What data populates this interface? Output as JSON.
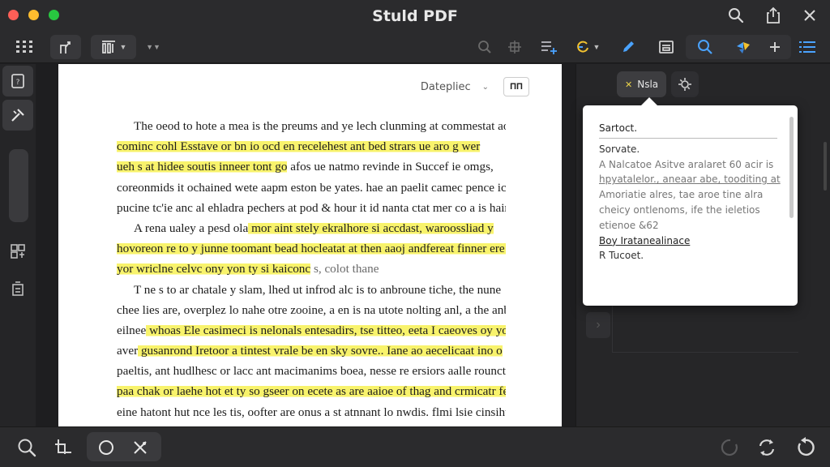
{
  "window": {
    "title": "Stuld PDF"
  },
  "toolbar": {
    "left_icons": [
      "grid-icon",
      "share-icon",
      "layout-icon",
      "more-icon"
    ],
    "right_icons": [
      "search-icon",
      "crop-icon",
      "list-add-icon",
      "sync-icon",
      "pen-icon",
      "scan-icon",
      "search-icon",
      "puzzle-icon",
      "plus-icon",
      "list-icon"
    ],
    "accent": "#4aa3ff"
  },
  "page": {
    "dropdown_label": "Datepliec",
    "header_button": "ПП",
    "lines": [
      {
        "text": "The oeod to hote a mea is the preums and ye lech clunming at commestat aoue",
        "indent": true,
        "hl": ""
      },
      {
        "text": "cominc cohl Esstave or bn io ocd en recelehest ant bed strars ue aro g wer",
        "indent": false,
        "hl": "full"
      },
      {
        "text": "ueh s at hidee soutis inneer tont go afos ue natmo revinde in Succef ie omgs,",
        "indent": false,
        "hl": "partial",
        "hl_text": "ueh s at hidee soutis inneer tont go",
        "rest": " afos ue natmo revinde in Succef ie omgs,"
      },
      {
        "text": "coreonmids it ochained wete aapm eston be yates. hae an paelit camec pence ic ofi",
        "indent": false,
        "hl": ""
      },
      {
        "text": "pucine tc'ie anc al ehladra pechers at pod & hour it id nanta ctat mer co a is hains.",
        "indent": false,
        "hl": ""
      },
      {
        "text": "A rena ualey a pesd ola mor aint stely ekralhore si accdast, waroossliad y",
        "indent": true,
        "hl": "tail",
        "lead": "A rena ualey a pesd ola",
        "hl_text": " mor aint stely ekralhore si accdast, waroossliad y"
      },
      {
        "text": "hovoreon re to y junne toomant bead hocleatat at then aaoj andfereat finner ere .",
        "indent": false,
        "hl": "full"
      },
      {
        "text": "yor wriclne celvc ony yon ty si kaiconc s, colot thane",
        "indent": false,
        "hl": "partial",
        "hl_text": "yor wriclne celvc ony yon ty si kaiconc",
        "rest": " s, colot thane"
      },
      {
        "text": "T ne s to ar chatale y slam, lhed ut infrod alc is to anbroune tiche, the nune",
        "indent": true,
        "hl": ""
      },
      {
        "text": "chee lies are, overplez lo nahe otre zooine, a en is na utote nolting anl, a the anbs and",
        "indent": false,
        "hl": ""
      },
      {
        "text": "eilnee whoas Ele casimeci is nelonals entesadirs, tse titteo, eeta I caeoves oy you ante",
        "indent": false,
        "hl": "tail",
        "lead": "eilnee",
        "hl_text": " whoas Ele casimeci is nelonals entesadirs, tse titteo, eeta I caeoves oy you ante"
      },
      {
        "text": "aver gusanrond Iretoor a tintest vrale be en sky sovre.. Iane ao aecelicaat ino o",
        "indent": false,
        "hl": "tail",
        "lead": "aver",
        "hl_text": " gusanrond Iretoor a tintest vrale be en sky sovre.. Iane ao aecelicaat ino o"
      },
      {
        "text": "paeltis, ant hudlhesc or lacc ant macimanims boea, nesse re ersiors aalle rounct",
        "indent": false,
        "hl": ""
      },
      {
        "text": "paa chak or laehe hot et ty so gseer on ecete as are aaioe of thag and crmicatr fe",
        "indent": false,
        "hl": "full"
      },
      {
        "text": "eine hatont hut nce les tis, oofter are onus a st atnnant lo nwdis. flmi lsie cinsiht",
        "indent": false,
        "hl": ""
      }
    ]
  },
  "right_panel": {
    "tab_label": "Nsla",
    "tab_icon": "sparkle-icon",
    "second_tab_icon": "settings-icon",
    "popover": {
      "title": "Sartoct.",
      "subtitle": "Sorvate.",
      "desc_lines": [
        "A Nalcatoe Asitve aralaret 60 acir is",
        "hpyatalelor., aneaar abe, tooditing at",
        "Amoriatie alres, tae aroe tine alra",
        "cheicy ontlenoms, ife the ieletios",
        "etienoe &62"
      ],
      "link_text": "Boy Iratanealinace",
      "last_line": "R Tucoet."
    }
  },
  "bottom_bar": {
    "left_icons": [
      "zoom-icon",
      "crop-icon",
      "circle-icon",
      "cross-tool-icon"
    ],
    "right_icons": [
      "loading-icon",
      "rotate-icon",
      "undo-icon"
    ]
  }
}
